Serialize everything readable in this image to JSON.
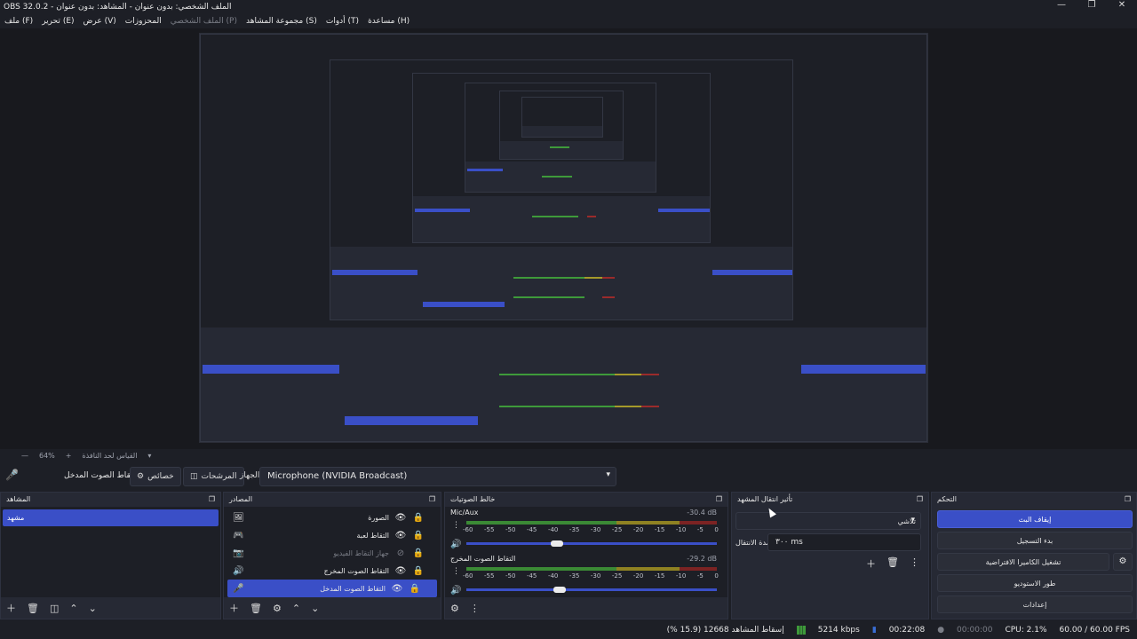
{
  "window": {
    "title": "OBS 32.0.2 - الملف الشخصي: بدون عنوان - المشاهد: بدون عنوان",
    "minimize": "—",
    "maximize": "❐",
    "close": "✕"
  },
  "menu": {
    "file": "ملف (F)",
    "edit": "تحرير (E)",
    "view": "عرض (V)",
    "docks": "المحزوزات",
    "profile": "الملف الشخصي (P)",
    "scene_collection": "مجموعة المشاهد (S)",
    "tools": "أدوات (T)",
    "help": "مساعدة (H)"
  },
  "zoom": {
    "value": "64%",
    "plus": "+",
    "minus": "—",
    "label": "القياس لحد النافذة",
    "caret": "▾"
  },
  "toolbar": {
    "source_name": "التقاط الصوت المدخل",
    "properties": "خصائص",
    "filters": "المرشحات",
    "device_label": "الجهاز",
    "device_value": "Microphone (NVIDIA Broadcast)"
  },
  "scenes": {
    "title": "المشاهد",
    "items": [
      "مشهد"
    ]
  },
  "sources": {
    "title": "المصادر",
    "items": [
      {
        "label": "الصورة",
        "icon": "🖼",
        "dim": false
      },
      {
        "label": "التقاط لعبة",
        "icon": "🎮",
        "dim": false
      },
      {
        "label": "جهاز التقاط الفيديو",
        "icon": "📷",
        "dim": true
      },
      {
        "label": "التقاط الصوت المخرج",
        "icon": "🔊",
        "dim": false
      },
      {
        "label": "التقاط الصوت المدخل",
        "icon": "🎤",
        "dim": false,
        "selected": true
      }
    ]
  },
  "mixer": {
    "title": "خالط الصوتيات",
    "channels": [
      {
        "name": "Mic/Aux",
        "db": "-30.4 dB",
        "volume": 0.36
      },
      {
        "name": "التقاط الصوت المخرج",
        "db": "-29.2 dB",
        "volume": 0.37
      }
    ],
    "ticks": [
      "-60",
      "-55",
      "-50",
      "-45",
      "-40",
      "-35",
      "-30",
      "-25",
      "-20",
      "-15",
      "-10",
      "-5",
      "0"
    ]
  },
  "transitions": {
    "title": "تأثير انتقال المشهد",
    "type": "تلاشي",
    "duration_label": "مدة الانتقال",
    "duration_value": "٣٠٠ ms"
  },
  "controls": {
    "title": "التحكم",
    "stop_stream": "إيقاف البث",
    "start_record": "بدء التسجيل",
    "virtual_camera": "تشغيل الكاميرا الافتراضية",
    "studio_mode": "طور الاستوديو",
    "settings": "إعدادات"
  },
  "status": {
    "dropped_frames": "إسقاط المشاهد 12668 (15.9 %)",
    "bitrate": "5214 kbps",
    "stream_time": "00:22:08",
    "record_time": "00:00:00",
    "cpu": "CPU: 2.1%",
    "fps": "60.00 / 60.00 FPS"
  },
  "colors": {
    "accent": "#3a4fc7",
    "bg": "#1d1f26",
    "panel": "#262934",
    "meter_green": "#3b8a35",
    "meter_yellow": "#8f8222",
    "meter_red": "#7c2323"
  }
}
